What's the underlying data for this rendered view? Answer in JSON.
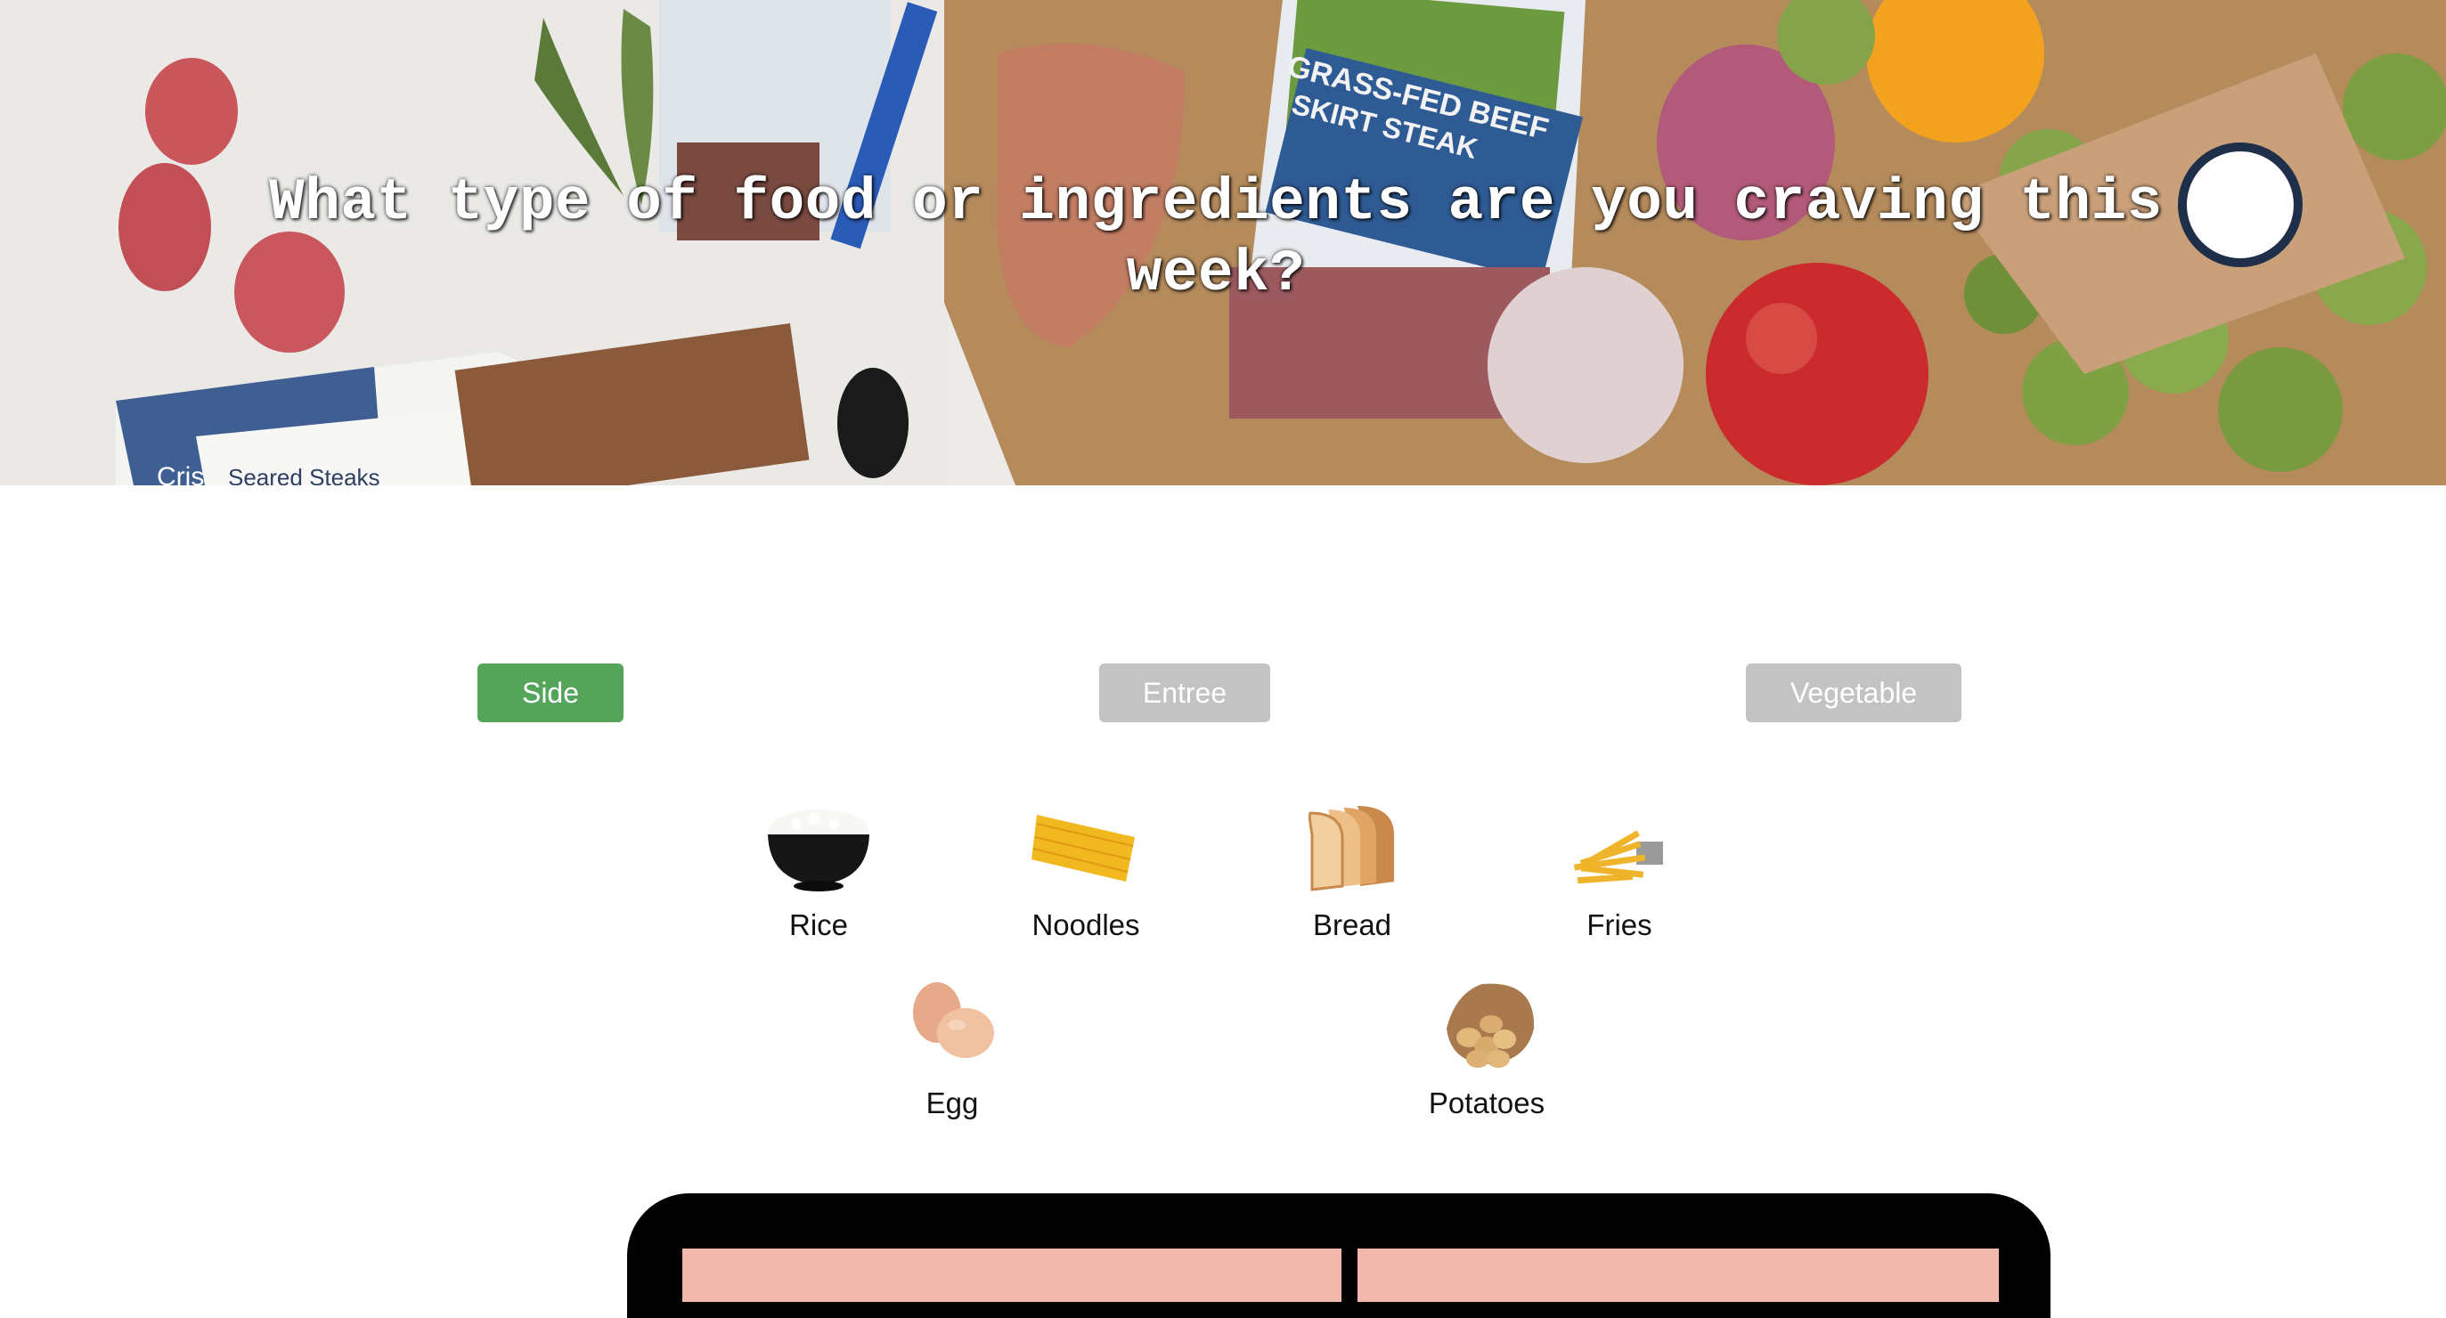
{
  "hero": {
    "title": "What type of food or ingredients are you craving this week?",
    "background": "meal-kit-box-photo",
    "package_text_1": "GRASS-FED BEEF",
    "package_text_2": "SKIRT STEAK",
    "card_text_1": "Cris",
    "card_text_2": "Seared Steaks"
  },
  "tabs": [
    {
      "label": "Side",
      "state": "active"
    },
    {
      "label": "Entree",
      "state": "inactive"
    },
    {
      "label": "Vegetable",
      "state": "inactive"
    }
  ],
  "colors": {
    "active_tab": "#54a55a",
    "inactive_tab": "#c3c3c3",
    "panel": "#000000",
    "panel_slot": "#f2b8ab"
  },
  "foods": [
    {
      "label": "Rice",
      "icon": "rice-bowl-icon"
    },
    {
      "label": "Noodles",
      "icon": "noodles-icon"
    },
    {
      "label": "Bread",
      "icon": "bread-icon"
    },
    {
      "label": "Fries",
      "icon": "fries-icon"
    },
    {
      "label": "Egg",
      "icon": "egg-icon"
    },
    {
      "label": "Potatoes",
      "icon": "potatoes-icon"
    }
  ]
}
